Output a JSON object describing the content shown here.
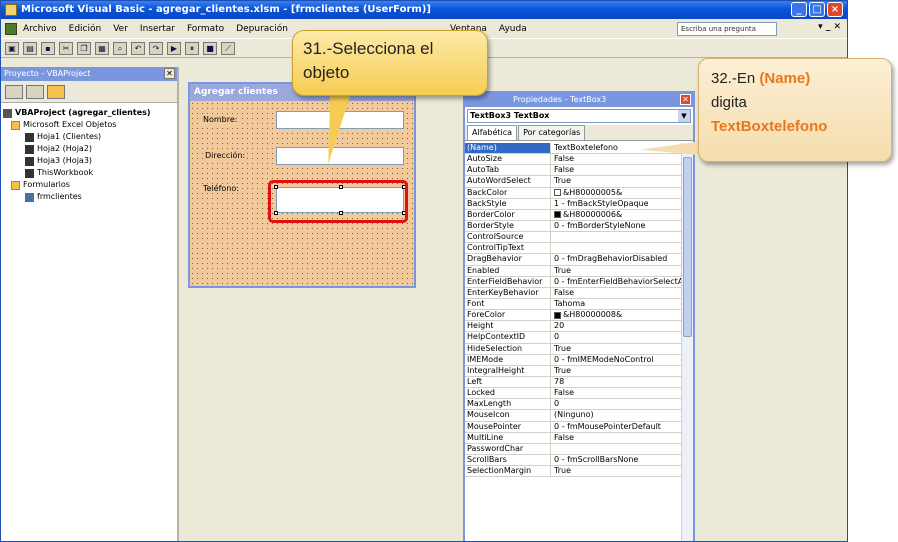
{
  "window": {
    "title": "Microsoft Visual Basic - agregar_clientes.xlsm - [frmclientes (UserForm)]"
  },
  "menu": {
    "items": [
      "Archivo",
      "Edición",
      "Ver",
      "Insertar",
      "Formato",
      "Depuración",
      "Ventana",
      "Ayuda"
    ],
    "ask_placeholder": "Escriba una pregunta"
  },
  "project_panel": {
    "title": "Proyecto - VBAProject",
    "tree": [
      {
        "label": "VBAProject (agregar_clientes)",
        "level": 0,
        "icon": "project-icon"
      },
      {
        "label": "Microsoft Excel Objetos",
        "level": 1,
        "icon": "folder-icon"
      },
      {
        "label": "Hoja1 (Clientes)",
        "level": 2,
        "icon": "sheet-icon"
      },
      {
        "label": "Hoja2 (Hoja2)",
        "level": 2,
        "icon": "sheet-icon"
      },
      {
        "label": "Hoja3 (Hoja3)",
        "level": 2,
        "icon": "sheet-icon"
      },
      {
        "label": "ThisWorkbook",
        "level": 2,
        "icon": "workbook-icon"
      },
      {
        "label": "Formularios",
        "level": 1,
        "icon": "folder-icon"
      },
      {
        "label": "frmclientes",
        "level": 2,
        "icon": "form-icon"
      }
    ]
  },
  "userform": {
    "title": "Agregar clientes",
    "labels": {
      "nombre": "Nombre:",
      "direccion": "Dirección:",
      "telefono": "Teléfono:"
    }
  },
  "callout1": {
    "text": "31.-Selecciona el objeto"
  },
  "callout2": {
    "prefix": "32.-En ",
    "accent1": "(Name)",
    "middle": "digita",
    "accent2": "TextBoxtelefono"
  },
  "properties": {
    "title": "Propiedades - TextBox3",
    "object": "TextBox3 TextBox",
    "tabs": [
      "Alfabética",
      "Por categorías"
    ],
    "rows": [
      {
        "name": "(Name)",
        "value": "TextBoxtelefono"
      },
      {
        "name": "AutoSize",
        "value": "False"
      },
      {
        "name": "AutoTab",
        "value": "False"
      },
      {
        "name": "AutoWordSelect",
        "value": "True"
      },
      {
        "name": "BackColor",
        "value": "&H80000005&",
        "color": "#ffffff"
      },
      {
        "name": "BackStyle",
        "value": "1 - fmBackStyleOpaque"
      },
      {
        "name": "BorderColor",
        "value": "&H80000006&",
        "color": "#000000"
      },
      {
        "name": "BorderStyle",
        "value": "0 - fmBorderStyleNone"
      },
      {
        "name": "ControlSource",
        "value": ""
      },
      {
        "name": "ControlTipText",
        "value": ""
      },
      {
        "name": "DragBehavior",
        "value": "0 - fmDragBehaviorDisabled"
      },
      {
        "name": "Enabled",
        "value": "True"
      },
      {
        "name": "EnterFieldBehavior",
        "value": "0 - fmEnterFieldBehaviorSelectA"
      },
      {
        "name": "EnterKeyBehavior",
        "value": "False"
      },
      {
        "name": "Font",
        "value": "Tahoma"
      },
      {
        "name": "ForeColor",
        "value": "&H80000008&",
        "color": "#000000"
      },
      {
        "name": "Height",
        "value": "20"
      },
      {
        "name": "HelpContextID",
        "value": "0"
      },
      {
        "name": "HideSelection",
        "value": "True"
      },
      {
        "name": "IMEMode",
        "value": "0 - fmIMEModeNoControl"
      },
      {
        "name": "IntegralHeight",
        "value": "True"
      },
      {
        "name": "Left",
        "value": "78"
      },
      {
        "name": "Locked",
        "value": "False"
      },
      {
        "name": "MaxLength",
        "value": "0"
      },
      {
        "name": "MouseIcon",
        "value": "(Ninguno)"
      },
      {
        "name": "MousePointer",
        "value": "0 - fmMousePointerDefault"
      },
      {
        "name": "MultiLine",
        "value": "False"
      },
      {
        "name": "PasswordChar",
        "value": ""
      },
      {
        "name": "ScrollBars",
        "value": "0 - fmScrollBarsNone"
      },
      {
        "name": "SelectionMargin",
        "value": "True"
      }
    ]
  }
}
